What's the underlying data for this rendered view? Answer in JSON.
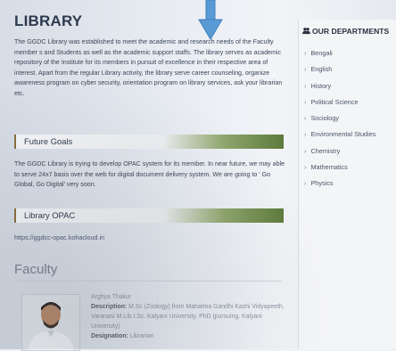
{
  "main": {
    "title": "LIBRARY",
    "intro": "The GGDC Library was established to meet the academic and research needs of the Faculty member s and Students as well as the academic support staffs. The library serves as academic repository of the Institute for its members in pursuit of excellence in their respective area of interest. Apart from the regular Library activity, the library serve career counseling, organize awareness program on cyber security, orientation program on library services, ask your librarian etc.",
    "future_goals": {
      "heading": "Future Goals",
      "text": "The GGDC Library is trying to develop OPAC system for its member. In near future, we may able to serve 24x7 basis over the web for digital document delivery system. We are going to ' Go Global, Go Digital' very soon."
    },
    "opac": {
      "heading": "Library OPAC",
      "link": "https://ggdcc-opac.kohacloud.in"
    },
    "faculty": {
      "heading": "Faculty",
      "name": "Arghya Thakur",
      "description_label": "Description:",
      "description": "M.Sc (Zoology) from Mahatma Gandhi Kashi Vidyapeeth, Varanasi M.Lib.I.Sc. Kalyani University, PhD (pursuing, Kalyani University)",
      "designation_label": "Designation:",
      "designation": "Librarian"
    }
  },
  "sidebar": {
    "title": "OUR DEPARTMENTS",
    "title_icon": "users-icon",
    "departments": [
      "Bengali",
      "English",
      "History",
      "Political Science",
      "Sociology",
      "Environmental Studies",
      "Chemistry",
      "Mathematics",
      "Physics"
    ]
  },
  "colors": {
    "section_bar_accent": "#5e7a3c",
    "pointer": "#5b9bd5",
    "heading": "#2d3a4e"
  }
}
